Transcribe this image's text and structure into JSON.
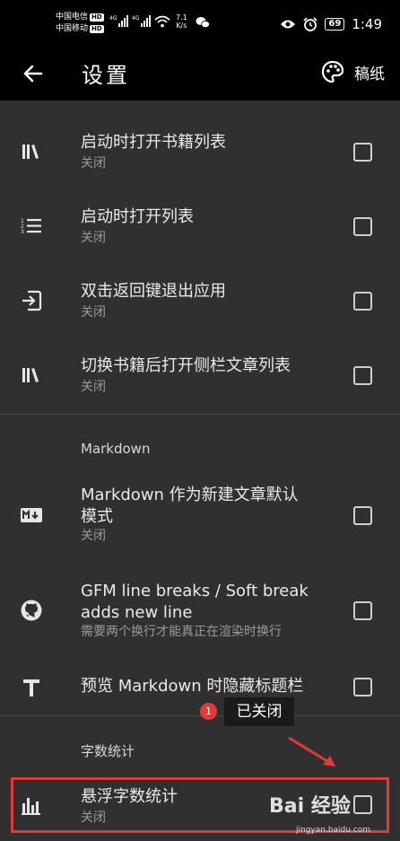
{
  "status_bar": {
    "carrier1": "中国电信",
    "carrier2": "中国移动",
    "hd": "HD",
    "net_type": "4G",
    "speed_value": "7.1",
    "speed_unit": "K/s",
    "battery": "69",
    "time": "1:49"
  },
  "app_bar": {
    "title": "设置",
    "theme_label": "稿纸"
  },
  "items": [
    {
      "title": "启动时打开书籍列表",
      "subtitle": "关闭",
      "icon": "books-icon",
      "checked": false
    },
    {
      "title": "启动时打开列表",
      "subtitle": "关闭",
      "icon": "numbered-list-icon",
      "checked": false
    },
    {
      "title": "双击返回键退出应用",
      "subtitle": "关闭",
      "icon": "exit-icon",
      "checked": false
    },
    {
      "title": "切换书籍后打开侧栏文章列表",
      "subtitle": "关闭",
      "icon": "books-icon",
      "checked": false
    }
  ],
  "markdown_section": {
    "header": "Markdown",
    "items": [
      {
        "title_line1": "Markdown 作为新建文章默认",
        "title_line2": "模式",
        "subtitle": "关闭",
        "icon": "markdown-icon"
      },
      {
        "title_line1": "GFM line breaks / Soft break",
        "title_line2": "adds new line",
        "subtitle": "需要两个换行才能真正在渲染时换行",
        "icon": "github-icon"
      },
      {
        "title": "预览 Markdown 时隐藏标题栏",
        "icon": "text-t-icon"
      }
    ]
  },
  "wordcount_section": {
    "header": "字数统计",
    "items": [
      {
        "title": "悬浮字数统计",
        "subtitle": "关闭",
        "icon": "bar-chart-icon"
      }
    ]
  },
  "overlay": {
    "toast": "已关闭",
    "badge": "1",
    "watermark": "Bai 经验",
    "watermark_url": "jingyan.baidu.com"
  },
  "colors": {
    "background": "#303030",
    "bar": "#000000",
    "highlight": "#e53935"
  }
}
